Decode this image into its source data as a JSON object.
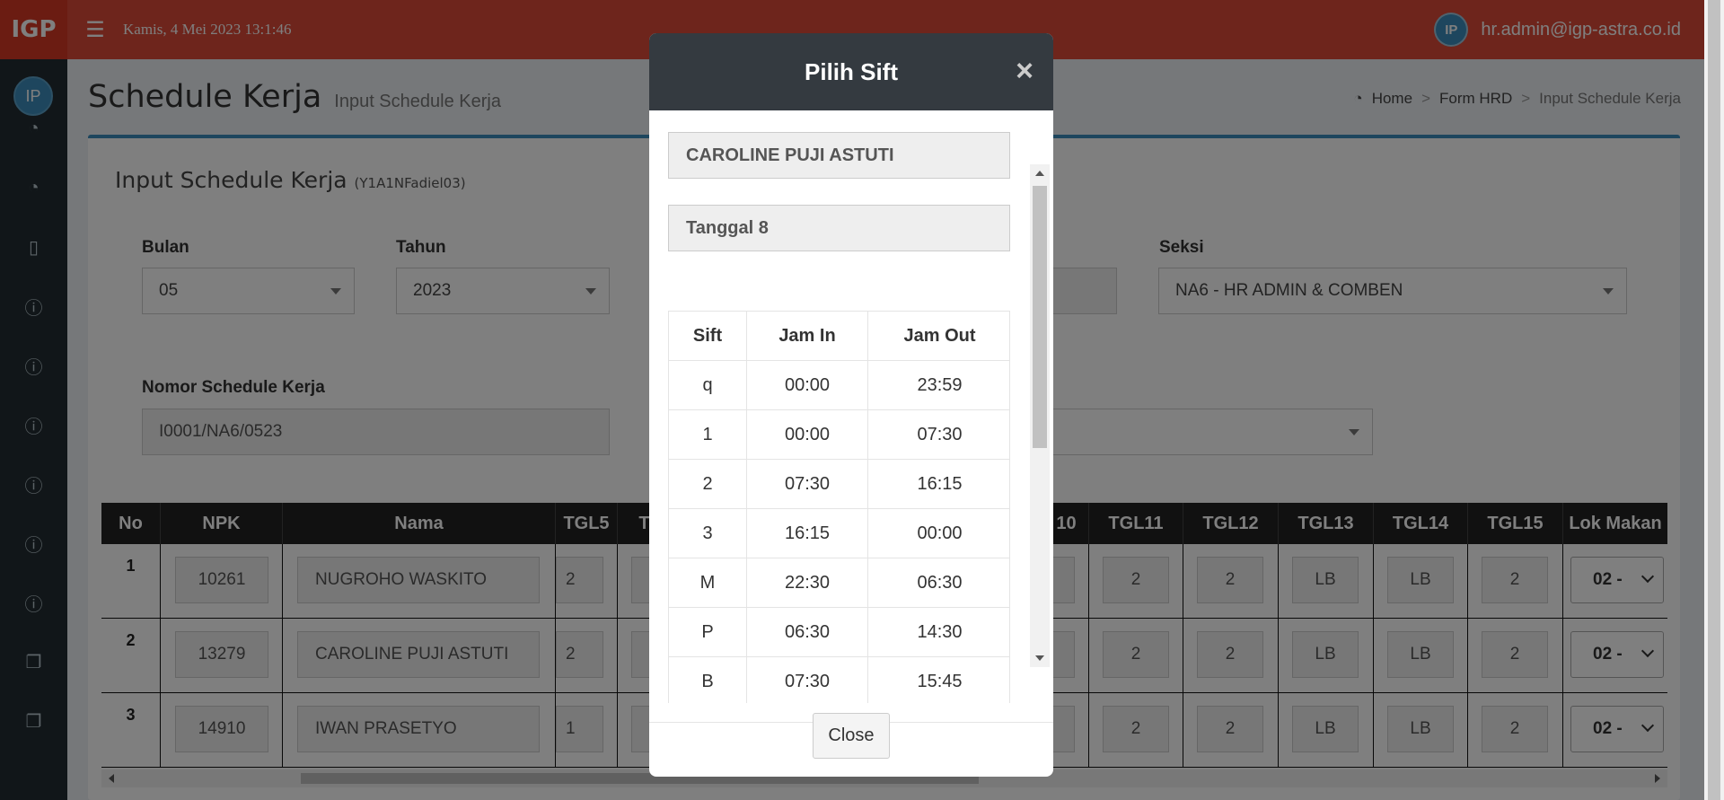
{
  "header": {
    "logo": "IGP",
    "datetime": "Kamis, 4 Mei 2023 13:1:46",
    "user_initials": "IP",
    "user_email": "hr.admin@igp-astra.co.id"
  },
  "sidebar": {
    "avatar_initials": "IP",
    "icons": [
      "dashboard-icon",
      "dashboard-icon",
      "mobile-icon",
      "info-icon",
      "info-icon",
      "info-icon",
      "info-icon",
      "info-icon",
      "info-icon",
      "copy-icon",
      "copy-icon"
    ]
  },
  "page": {
    "title": "Schedule Kerja",
    "subtitle": "Input Schedule Kerja",
    "breadcrumb": [
      "Home",
      "Form HRD",
      "Input Schedule Kerja"
    ]
  },
  "form": {
    "box_title": "Input Schedule Kerja",
    "box_code": "(Y1A1NFadiel03)",
    "bulan_label": "Bulan",
    "bulan_value": "05",
    "tahun_label": "Tahun",
    "tahun_value": "2023",
    "seksi_label": "Seksi",
    "seksi_value": "NA6 - HR ADMIN & COMBEN",
    "nomor_label": "Nomor Schedule Kerja",
    "nomor_value": "I0001/NA6/0523"
  },
  "table": {
    "headers": {
      "no": "No",
      "npk": "NPK",
      "nama": "Nama",
      "tgl5": "TGL5",
      "t": "T",
      "tgl10": "10",
      "tgl11": "TGL11",
      "tgl12": "TGL12",
      "tgl13": "TGL13",
      "tgl14": "TGL14",
      "tgl15": "TGL15",
      "lok": "Lok Makan"
    },
    "rows": [
      {
        "no": "1",
        "npk": "10261",
        "nama": "NUGROHO WASKITO",
        "tgl5": "2",
        "tgl11": "2",
        "tgl12": "2",
        "tgl13": "LB",
        "tgl14": "LB",
        "tgl15": "2",
        "lok": "02 -"
      },
      {
        "no": "2",
        "npk": "13279",
        "nama": "CAROLINE PUJI ASTUTI",
        "tgl5": "2",
        "tgl11": "2",
        "tgl12": "2",
        "tgl13": "LB",
        "tgl14": "LB",
        "tgl15": "2",
        "lok": "02 -"
      },
      {
        "no": "3",
        "npk": "14910",
        "nama": "IWAN PRASETYO",
        "tgl5": "1",
        "tgl11": "2",
        "tgl12": "2",
        "tgl13": "LB",
        "tgl14": "LB",
        "tgl15": "2",
        "lok": "02 -"
      }
    ]
  },
  "modal": {
    "title": "Pilih Sift",
    "close_x": "×",
    "employee": "CAROLINE PUJI ASTUTI",
    "tanggal": "Tanggal 8",
    "columns": {
      "sift": "Sift",
      "jam_in": "Jam In",
      "jam_out": "Jam Out"
    },
    "rows": [
      {
        "sift": "q",
        "in": "00:00",
        "out": "23:59"
      },
      {
        "sift": "1",
        "in": "00:00",
        "out": "07:30"
      },
      {
        "sift": "2",
        "in": "07:30",
        "out": "16:15"
      },
      {
        "sift": "3",
        "in": "16:15",
        "out": "00:00"
      },
      {
        "sift": "M",
        "in": "22:30",
        "out": "06:30"
      },
      {
        "sift": "P",
        "in": "06:30",
        "out": "14:30"
      },
      {
        "sift": "B",
        "in": "07:30",
        "out": "15:45"
      }
    ],
    "close_button": "Close"
  },
  "colors": {
    "header_red": "#dd4b39",
    "sidebar_dark": "#222d32",
    "accent_blue": "#3c8dbc",
    "modal_header": "#343a40"
  }
}
